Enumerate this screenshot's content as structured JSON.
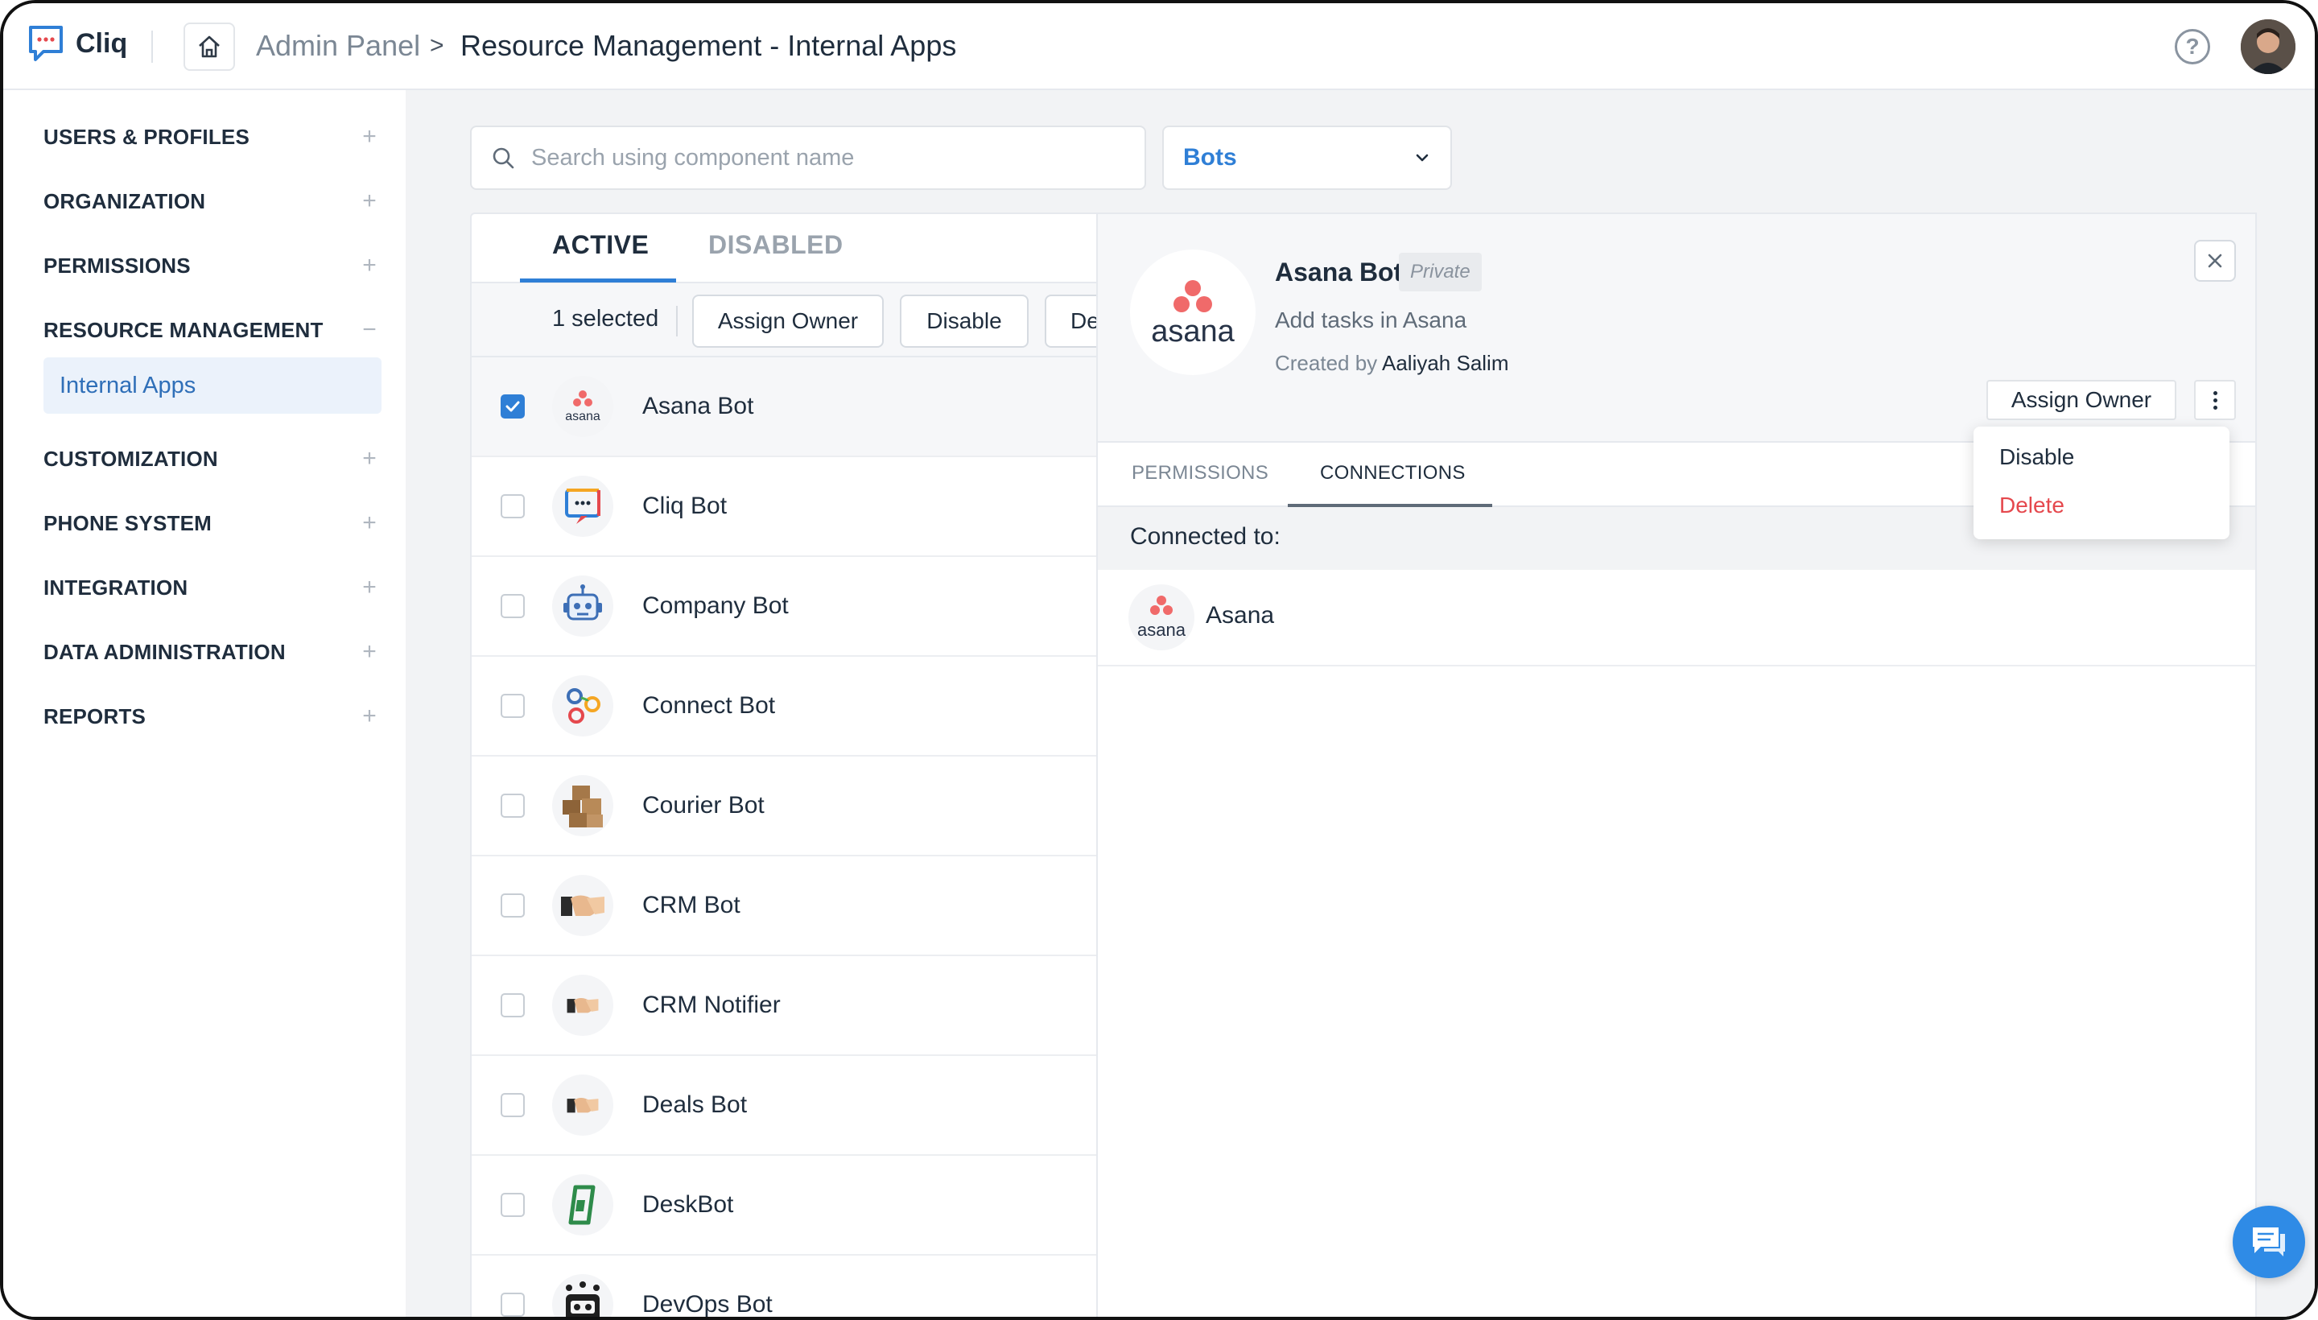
{
  "app": {
    "name": "Cliq"
  },
  "breadcrumb": {
    "root": "Admin Panel",
    "separator": ">",
    "current": "Resource Management - Internal Apps"
  },
  "sidebar": {
    "items": [
      {
        "label": "USERS & PROFILES",
        "toggle": "+"
      },
      {
        "label": "ORGANIZATION",
        "toggle": "+"
      },
      {
        "label": "PERMISSIONS",
        "toggle": "+"
      },
      {
        "label": "RESOURCE MANAGEMENT",
        "toggle": "−"
      },
      {
        "label": "CUSTOMIZATION",
        "toggle": "+"
      },
      {
        "label": "PHONE SYSTEM",
        "toggle": "+"
      },
      {
        "label": "INTEGRATION",
        "toggle": "+"
      },
      {
        "label": "DATA ADMINISTRATION",
        "toggle": "+"
      },
      {
        "label": "REPORTS",
        "toggle": "+"
      }
    ],
    "active_sub": "Internal Apps"
  },
  "search": {
    "placeholder": "Search using component name"
  },
  "filter": {
    "selected": "Bots"
  },
  "list": {
    "tabs": [
      "ACTIVE",
      "DISABLED"
    ],
    "active_tab": "ACTIVE",
    "selected_count": "1 selected",
    "bulk_actions": [
      "Assign Owner",
      "Disable",
      "De"
    ],
    "rows": [
      {
        "name": "Asana Bot",
        "checked": true,
        "icon": "asana-icon"
      },
      {
        "name": "Cliq Bot",
        "checked": false,
        "icon": "cliq-icon"
      },
      {
        "name": "Company Bot",
        "checked": false,
        "icon": "robot-icon"
      },
      {
        "name": "Connect Bot",
        "checked": false,
        "icon": "connect-icon"
      },
      {
        "name": "Courier Bot",
        "checked": false,
        "icon": "boxes-icon"
      },
      {
        "name": "CRM Bot",
        "checked": false,
        "icon": "handshake-icon"
      },
      {
        "name": "CRM Notifier",
        "checked": false,
        "icon": "handshake-icon"
      },
      {
        "name": "Deals Bot",
        "checked": false,
        "icon": "handshake-icon"
      },
      {
        "name": "DeskBot",
        "checked": false,
        "icon": "desk-icon"
      },
      {
        "name": "DevOps Bot",
        "checked": false,
        "icon": "devops-robot-icon"
      }
    ]
  },
  "detail": {
    "title": "Asana Bot",
    "badge": "Private",
    "description": "Add tasks in Asana",
    "created_by_label": "Created by",
    "created_by": "Aaliyah Salim",
    "logo_word": "asana",
    "assign_owner": "Assign Owner",
    "tabs": [
      "PERMISSIONS",
      "CONNECTIONS"
    ],
    "active_tab": "CONNECTIONS",
    "connected_label": "Connected to:",
    "connections": [
      {
        "name": "Asana",
        "logo_word": "asana"
      }
    ]
  },
  "menu": {
    "items": [
      "Disable",
      "Delete"
    ]
  },
  "colors": {
    "accent": "#2f7fd6",
    "danger": "#e5484d",
    "asana": "#f06a6a"
  }
}
